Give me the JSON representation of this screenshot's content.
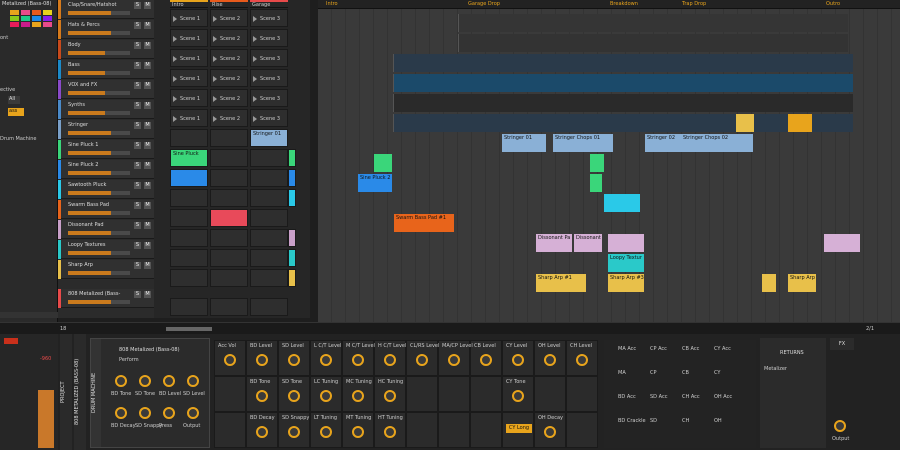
{
  "inspector": {
    "title": "Metalized (Bass-08)",
    "labels": [
      "ont",
      "ective",
      "All",
      "ass"
    ],
    "drum_machine": "Drum Machine",
    "pads_colors": [
      "#e8a41c",
      "#e84b8a",
      "#e85a1c",
      "#e8d21c",
      "#8ac91c",
      "#1cc98a",
      "#1c8ae8",
      "#8a1ce8",
      "#e81c5a",
      "#c91c8a",
      "#e8a41c",
      "#e84b8a"
    ]
  },
  "tracks": [
    {
      "name": "Clap/Snare/Hatshot",
      "color": "#d67a1b",
      "level": 0.7
    },
    {
      "name": "Hats & Percs",
      "color": "#d67a1b",
      "level": 0.7
    },
    {
      "name": "Body",
      "color": "#c94a1b",
      "level": 0.6
    },
    {
      "name": "Bass",
      "color": "#1b8ac9",
      "level": 0.6
    },
    {
      "name": "VOX and FX",
      "color": "#8a4ac9",
      "level": 0.6
    },
    {
      "name": "Synths",
      "color": "#4a8ac9",
      "level": 0.6
    },
    {
      "name": "Stringer",
      "color": "#7aa0c9",
      "level": 0.7
    },
    {
      "name": "Sine Pluck 1",
      "color": "#3ad67a",
      "level": 0.7
    },
    {
      "name": "Sine Pluck 2",
      "color": "#2a8ae8",
      "level": 0.7
    },
    {
      "name": "Sawtooth Pluck",
      "color": "#2ac9e8",
      "level": 0.7
    },
    {
      "name": "Swarm Bass Pad",
      "color": "#e8641b",
      "level": 0.7
    },
    {
      "name": "Dissonant Pad",
      "color": "#c9a0c9",
      "level": 0.7
    },
    {
      "name": "Loopy Textures",
      "color": "#2ac9c9",
      "level": 0.7
    },
    {
      "name": "Sharp Arp",
      "color": "#e8c04a",
      "level": 0.7
    },
    {
      "name": "808 Metalized (Bass-",
      "color": "#e84a4a",
      "level": 0.7
    }
  ],
  "track_buttons": {
    "s": "S",
    "m": "M"
  },
  "launcher": {
    "columns": [
      "Intro",
      "Rise",
      "Garage"
    ],
    "scene_labels": [
      "Scene 1",
      "Scene 2",
      "Scene 3"
    ],
    "clips": {
      "stringer": "Stringer 01",
      "sine_pluck": "Sine Pluck"
    }
  },
  "arranger": {
    "markers": [
      "Intro",
      "Garage Drop",
      "Breakdown",
      "Trap Drop",
      "Outro"
    ],
    "clips": [
      {
        "label": "Stringer 01",
        "color": "#8ab0d6"
      },
      {
        "label": "Stringer Chops 01",
        "color": "#8ab0d6"
      },
      {
        "label": "Stringer 02",
        "color": "#8ab0d6"
      },
      {
        "label": "Stringer Chops 02",
        "color": "#8ab0d6"
      },
      {
        "label": "Sine Pluck 2 #",
        "color": "#2a8ae8"
      },
      {
        "label": "Swarm Bass Pad #1",
        "color": "#e8641b"
      },
      {
        "label": "Dissonant Pa",
        "color": "#d6b0d6"
      },
      {
        "label": "Dissonant",
        "color": "#d6b0d6"
      },
      {
        "label": "Loopy Textur",
        "color": "#2ac9c9"
      },
      {
        "label": "Sharp Arp #1",
        "color": "#e8c04a"
      },
      {
        "label": "Sharp Arp #3",
        "color": "#e8c04a"
      },
      {
        "label": "Sharp Arp",
        "color": "#e8c04a"
      }
    ],
    "page": "2/1"
  },
  "status": {
    "left": "18",
    "zoom": ""
  },
  "device": {
    "side_labels": [
      "PROJECT",
      "808 METALIZED (BASS-08)",
      "DRUM MACHINE"
    ],
    "preset_name": "808 Metalized (Bass-08)",
    "perform": "Perform",
    "knobs": [
      "BD Tone",
      "SD Tone",
      "BD Level",
      "SD Level",
      "BD Decay",
      "SD Snappy",
      "Press",
      "Output"
    ],
    "grid_top": [
      "Acc Vol",
      "BD Level",
      "SD Level",
      "L C/T Level",
      "M C/T Level",
      "H C/T Level",
      "CL/RS Level",
      "MA/CP Level",
      "CB Level",
      "CY Level",
      "OH Level",
      "CH Level"
    ],
    "grid_mid": [
      "BD Tone",
      "SD Tone",
      "LC Tuning",
      "MC Tuning",
      "HC Tuning",
      "CY Tone"
    ],
    "grid_bot": [
      "BD Decay",
      "SD Snappy",
      "LT Tuning",
      "MT Tuning",
      "HT Tuning",
      "OH Decay"
    ],
    "cy_long": "CY Long",
    "acc_grid": [
      [
        "MA Acc",
        "CP Acc",
        "CB Acc",
        "CY Acc"
      ],
      [
        "MA",
        "CP",
        "CB",
        "CY"
      ],
      [
        "BD Acc",
        "SD Acc",
        "CH Acc",
        "OH Acc"
      ],
      [
        "BD Crackle",
        "SD",
        "CH",
        "OH"
      ]
    ],
    "returns": "RETURNS",
    "returns_item": "Metalizer",
    "fx": "FX",
    "output": "Output",
    "db": "-960"
  }
}
